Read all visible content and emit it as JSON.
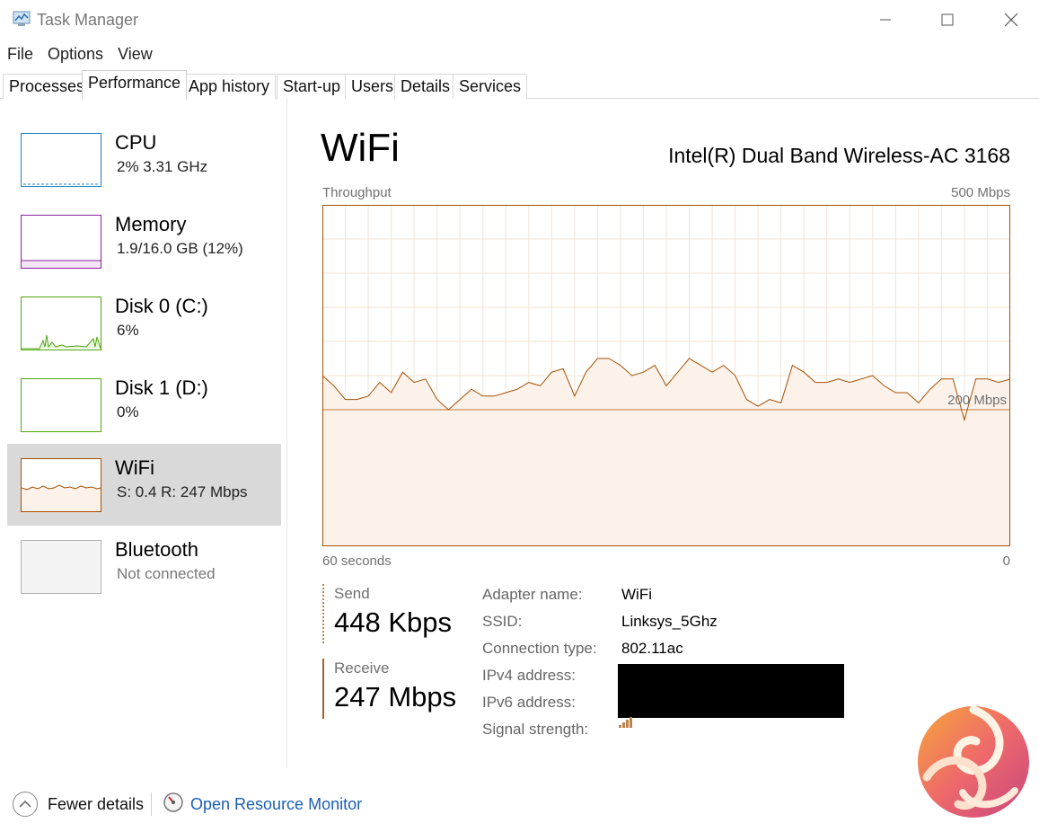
{
  "window": {
    "title": "Task Manager"
  },
  "menu": [
    "File",
    "Options",
    "View"
  ],
  "tabs": [
    {
      "label": "Processes",
      "active": false
    },
    {
      "label": "Performance",
      "active": true
    },
    {
      "label": "App history",
      "active": false
    },
    {
      "label": "Start-up",
      "active": false
    },
    {
      "label": "Users",
      "active": false
    },
    {
      "label": "Details",
      "active": false
    },
    {
      "label": "Services",
      "active": false
    }
  ],
  "sidebar": {
    "items": [
      {
        "name": "CPU",
        "sub": "2%  3.31 GHz",
        "color": "#1a82c5"
      },
      {
        "name": "Memory",
        "sub": "1.9/16.0 GB (12%)",
        "color": "#8b1fa0"
      },
      {
        "name": "Disk 0 (C:)",
        "sub": "6%",
        "color": "#4da60c"
      },
      {
        "name": "Disk 1 (D:)",
        "sub": "0%",
        "color": "#4da60c"
      },
      {
        "name": "WiFi",
        "sub": "S: 0.4  R: 247 Mbps",
        "color": "#a74f01",
        "selected": true
      },
      {
        "name": "Bluetooth",
        "sub": "Not connected",
        "color": "#b3b3b3"
      }
    ]
  },
  "main": {
    "title": "WiFi",
    "adapter": "Intel(R) Dual Band Wireless-AC 3168",
    "graph": {
      "label_top_left": "Throughput",
      "label_top_right": "500 Mbps",
      "label_bottom_left": "60 seconds",
      "label_bottom_right": "0",
      "reference_label": "200 Mbps"
    },
    "send": {
      "label": "Send",
      "value": "448 Kbps"
    },
    "receive": {
      "label": "Receive",
      "value": "247 Mbps"
    },
    "details": [
      {
        "label": "Adapter name:",
        "value": "WiFi"
      },
      {
        "label": "SSID:",
        "value": "Linksys_5Ghz"
      },
      {
        "label": "Connection type:",
        "value": "802.11ac"
      },
      {
        "label": "IPv4 address:",
        "value": ""
      },
      {
        "label": "IPv6 address:",
        "value": ""
      },
      {
        "label": "Signal strength:",
        "value": ""
      }
    ]
  },
  "chart_data": {
    "type": "area",
    "title": "Throughput",
    "xlabel": "60 seconds",
    "ylabel": "",
    "ylim": [
      0,
      500
    ],
    "xlim": [
      60,
      0
    ],
    "grid": true,
    "reference_line": 200,
    "series": [
      {
        "values": [
          250,
          235,
          215,
          215,
          220,
          240,
          225,
          255,
          240,
          245,
          215,
          200,
          215,
          230,
          220,
          220,
          225,
          230,
          240,
          235,
          255,
          260,
          220,
          255,
          275,
          275,
          265,
          250,
          255,
          265,
          235,
          255,
          275,
          265,
          255,
          265,
          250,
          215,
          205,
          215,
          210,
          265,
          255,
          240,
          240,
          245,
          240,
          245,
          250,
          235,
          225,
          225,
          210,
          230,
          245,
          245,
          185,
          245,
          245,
          240,
          245
        ]
      }
    ]
  },
  "bottom": {
    "fewer_details": "Fewer details",
    "resource_monitor": "Open Resource Monitor"
  },
  "colors": {
    "wifi_accent": "#a74f01",
    "grid": "#f2e3d6",
    "fill": "#fcf2ea"
  }
}
